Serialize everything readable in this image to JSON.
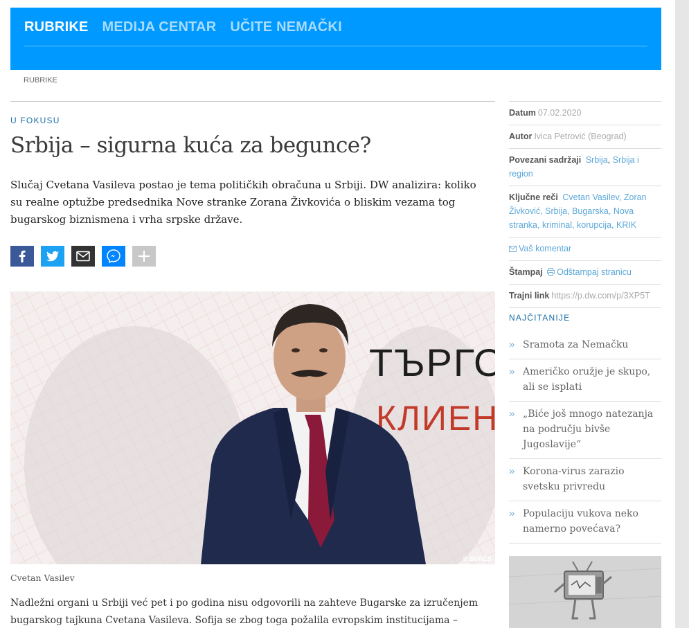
{
  "nav": {
    "items": [
      {
        "label": "RUBRIKE",
        "active": true
      },
      {
        "label": "MEDIJA CENTAR",
        "active": false
      },
      {
        "label": "UČITE NEMAČKI",
        "active": false
      }
    ]
  },
  "breadcrumb": "RUBRIKE",
  "article": {
    "kicker": "U FOKUSU",
    "title": "Srbija – sigurna kuća za begunce?",
    "intro": "Slučaj Cvetana Vasileva postao je tema političkih obračuna u Srbiji. DW analizira: koliko su realne optužbe predsednika Nove stranke Zorana Živkovića o bliskim vezama tog bugarskog biznismena i vrha srpske države.",
    "photo_sign_1": "ТЪРГО",
    "photo_sign_2": "КЛИЕНТ",
    "photo_credit": "© BGNES",
    "caption": "Cvetan Vasilev",
    "body": "Nadležni organi u Srbiji već pet i po godina nisu odgovorili na zahteve Bugarske za izručenjem bugarskog tajkuna Cvetana Vasileva. Sofija se zbog toga požalila evropskim institucijama –"
  },
  "share": [
    {
      "name": "facebook",
      "color": "#3b5998"
    },
    {
      "name": "twitter",
      "color": "#1da1f2"
    },
    {
      "name": "email",
      "color": "#333333"
    },
    {
      "name": "messenger",
      "color": "#0084ff"
    },
    {
      "name": "more",
      "color": "#c8c8c8"
    }
  ],
  "meta": {
    "date_label": "Datum",
    "date_value": "07.02.2020",
    "author_label": "Autor",
    "author_value": "Ivica Petrović (Beograd)",
    "related_label": "Povezani sadržaji",
    "related_links": [
      "Srbija",
      "Srbija i region"
    ],
    "keywords_label": "Ključne reči",
    "keywords": [
      "Cvetan Vasilev",
      "Zoran Živković",
      "Srbija",
      "Bugarska",
      "Nova stranka",
      "kriminal",
      "korupcija",
      "KRIK"
    ],
    "comment_label": "Vaš komentar",
    "print_label": "Štampaj",
    "print_link": "Odštampaj stranicu",
    "permalink_label": "Trajni link",
    "permalink_value": "https://p.dw.com/p/3XP5T"
  },
  "popular": {
    "title": "NAJČITANIJE",
    "items": [
      "Sramota za Nemačku",
      "Američko oružje je skupo, ali se isplati",
      "„Biće još mnogo natezanja na području bivše Jugoslavije“",
      "Korona-virus zarazio svetsku privredu",
      "Populaciju vukova neko namerno povećava?"
    ]
  },
  "colors": {
    "nav_bg": "#0099ff",
    "kicker": "#1a6fa8",
    "link": "#5aa7d8"
  }
}
